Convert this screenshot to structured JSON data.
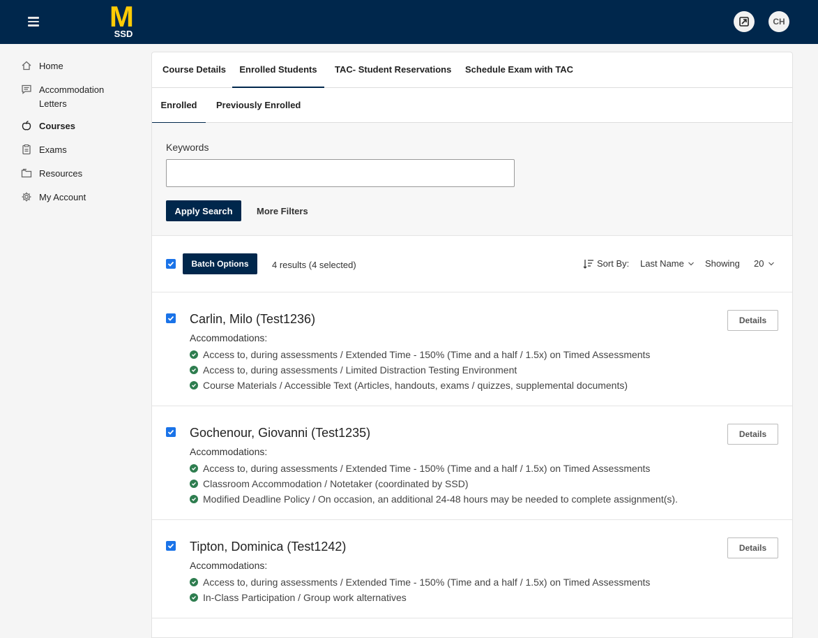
{
  "topbar": {
    "logo_letter": "M",
    "logo_text": "SSD",
    "avatar_initials": "CH"
  },
  "sidebar": {
    "items": [
      {
        "label": "Home",
        "icon": "home-icon"
      },
      {
        "label": "Accommodation Letters",
        "icon": "letters-icon"
      },
      {
        "label": "Courses",
        "icon": "apple-icon"
      },
      {
        "label": "Exams",
        "icon": "clipboard-icon"
      },
      {
        "label": "Resources",
        "icon": "folder-icon"
      },
      {
        "label": "My Account",
        "icon": "gear-icon"
      }
    ],
    "active": "Courses"
  },
  "tabs": [
    "Course Details",
    "Enrolled Students",
    "TAC- Student Reservations",
    "Schedule Exam with TAC"
  ],
  "subtabs": [
    "Enrolled",
    "Previously Enrolled"
  ],
  "filters": {
    "keywords_label": "Keywords",
    "keywords_value": "",
    "apply_label": "Apply Search",
    "more_label": "More Filters"
  },
  "toolbar": {
    "batch_label": "Batch Options",
    "results_text": "4 results (4 selected)",
    "sort_label": "Sort By:",
    "sort_value": "Last Name",
    "showing_label": "Showing",
    "showing_value": "20"
  },
  "students": [
    {
      "name": "Carlin, Milo (Test1236)",
      "acc_label": "Accommodations:",
      "accommodations": [
        "Access to, during assessments / Extended Time - 150% (Time and a half / 1.5x) on Timed Assessments",
        "Access to, during assessments / Limited Distraction Testing Environment",
        "Course Materials / Accessible Text (Articles, handouts, exams / quizzes, supplemental documents)"
      ],
      "details_label": "Details"
    },
    {
      "name": "Gochenour, Giovanni (Test1235)",
      "acc_label": "Accommodations:",
      "accommodations": [
        "Access to, during assessments / Extended Time - 150% (Time and a half / 1.5x) on Timed Assessments",
        "Classroom Accommodation / Notetaker (coordinated by SSD)",
        "Modified Deadline Policy / On occasion, an additional 24-48 hours may be needed to complete assignment(s)."
      ],
      "details_label": "Details"
    },
    {
      "name": "Tipton, Dominica (Test1242)",
      "acc_label": "Accommodations:",
      "accommodations": [
        "Access to, during assessments / Extended Time - 150% (Time and a half / 1.5x) on Timed Assessments",
        "In-Class Participation / Group work alternatives"
      ],
      "details_label": "Details"
    }
  ],
  "colors": {
    "navy": "#00274c",
    "maize": "#ffcb05",
    "checkbox": "#1a73e8",
    "success": "#2e7d4f"
  }
}
